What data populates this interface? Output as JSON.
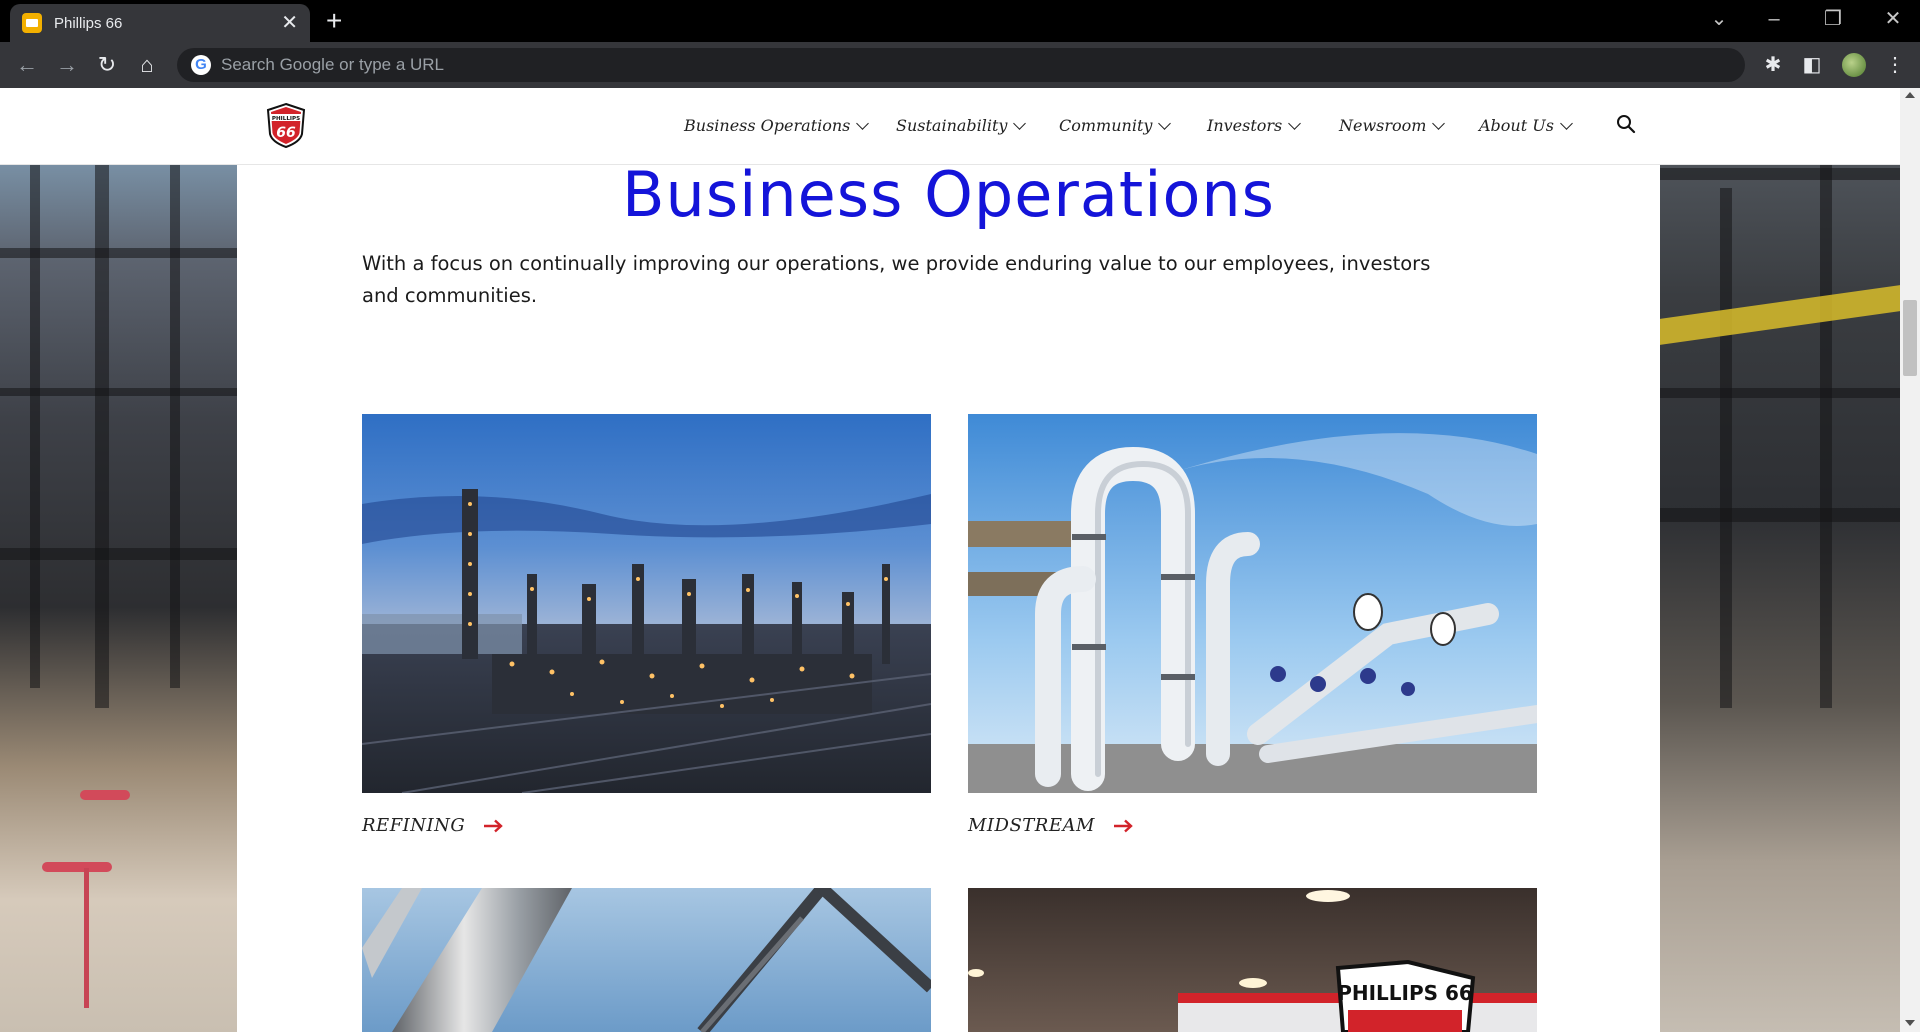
{
  "browser": {
    "tab_title": "Phillips 66",
    "omnibox_placeholder": "Search Google or type a URL"
  },
  "site": {
    "logo_text": "PHILLIPS 66",
    "nav": [
      {
        "label": "Business Operations"
      },
      {
        "label": "Sustainability"
      },
      {
        "label": "Community"
      },
      {
        "label": "Investors"
      },
      {
        "label": "Newsroom"
      },
      {
        "label": "About Us"
      }
    ]
  },
  "page": {
    "title": "Business Operations",
    "intro": "With a focus on continually improving our operations, we provide enduring value to our employees, investors and communities.",
    "cards": [
      {
        "label": "REFINING",
        "image": "refinery-at-dusk"
      },
      {
        "label": "MIDSTREAM",
        "image": "white-pipelines"
      },
      {
        "label": "",
        "image": "chemicals-pipes"
      },
      {
        "label": "",
        "image": "phillips-66-station-sign"
      }
    ]
  },
  "colors": {
    "title_blue": "#1414d9",
    "arrow_red": "#d2232a",
    "logo_red": "#d2232a"
  }
}
